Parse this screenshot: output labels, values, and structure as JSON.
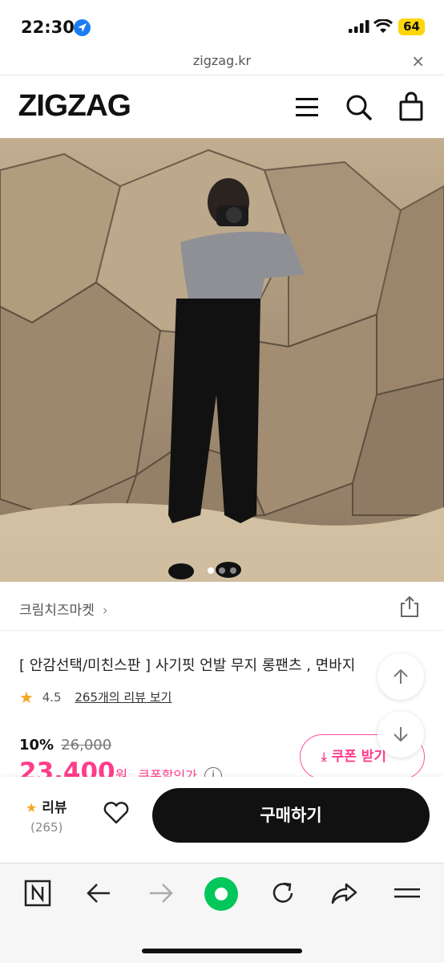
{
  "status_bar": {
    "time": "22:30",
    "battery": "64"
  },
  "browser": {
    "url": "zigzag.kr",
    "close": "×"
  },
  "header": {
    "logo": "ZIGZAG"
  },
  "store": {
    "name": "크림치즈마켓"
  },
  "product": {
    "title": "[ 안감선택/미친스판 ] 사기핏 언발 무지 롱팬츠 , 면바지",
    "rating": "4.5",
    "review_link": "265개의 리뷰 보기",
    "discount": "10%",
    "original_price": "26,000",
    "sale_price": "23,400",
    "currency": "원",
    "coupon_price_label": "쿠폰할인가",
    "info_icon": "i",
    "coupon_button": "쿠폰 받기"
  },
  "purchase_bar": {
    "review_label": "리뷰",
    "review_count": "(265)",
    "buy_button": "구매하기"
  },
  "colors": {
    "accent_pink": "#ff3d8b",
    "star": "#f5a623",
    "buy_button": "#111111"
  },
  "icons": [
    "location-arrow-icon",
    "signal-icon",
    "wifi-icon",
    "menu-icon",
    "search-icon",
    "bag-icon",
    "share-icon",
    "star-icon",
    "heart-icon",
    "arrow-up-icon",
    "arrow-down-icon",
    "download-icon",
    "naver-icon",
    "back-icon",
    "forward-icon",
    "green-dot-icon",
    "refresh-icon",
    "share-arrow-icon",
    "hamburger-icon"
  ]
}
